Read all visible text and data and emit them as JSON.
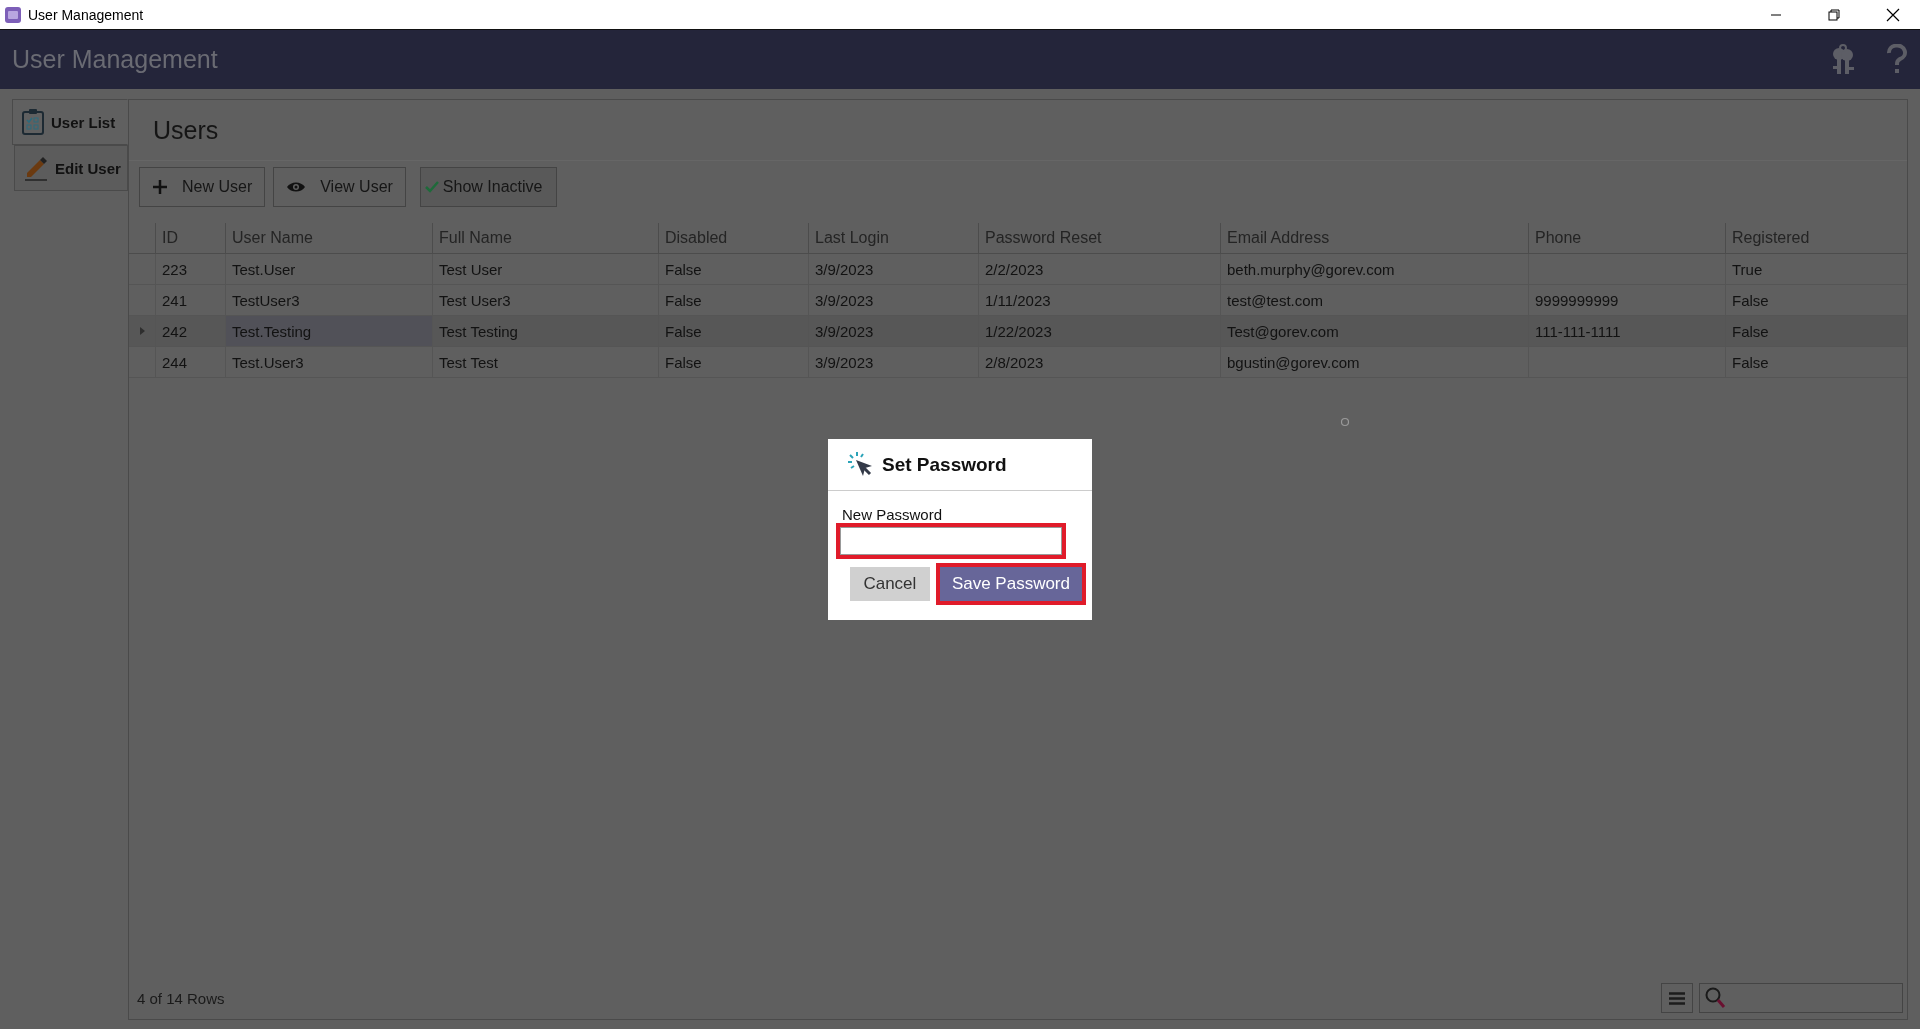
{
  "window": {
    "title": "User Management"
  },
  "header": {
    "title": "User Management"
  },
  "tabs": [
    {
      "label": "User List",
      "selected": true
    },
    {
      "label": "Edit User",
      "selected": false
    }
  ],
  "panel": {
    "title": "Users"
  },
  "toolbar": [
    {
      "label": "New User",
      "kind": "button"
    },
    {
      "label": "View User",
      "kind": "button"
    },
    {
      "label": "Show Inactive",
      "kind": "toggle",
      "checked": true
    }
  ],
  "table": {
    "columns": [
      "ID",
      "User Name",
      "Full Name",
      "Disabled",
      "Last Login",
      "Password Reset",
      "Email Address",
      "Phone",
      "Registered"
    ],
    "rows": [
      {
        "selected": false,
        "cells": [
          "223",
          "Test.User",
          "Test User",
          "False",
          "3/9/2023",
          "2/2/2023",
          "beth.murphy@gorev.com",
          "",
          "True"
        ]
      },
      {
        "selected": false,
        "cells": [
          "241",
          "TestUser3",
          "Test User3",
          "False",
          "3/9/2023",
          "1/11/2023",
          "test@test.com",
          "9999999999",
          "False"
        ]
      },
      {
        "selected": true,
        "cells": [
          "242",
          "Test.Testing",
          "Test Testing",
          "False",
          "3/9/2023",
          "1/22/2023",
          "Test@gorev.com",
          "111-111-1111",
          "False"
        ]
      },
      {
        "selected": false,
        "cells": [
          "244",
          "Test.User3",
          "Test Test",
          "False",
          "3/9/2023",
          "2/8/2023",
          "bgustin@gorev.com",
          "",
          "False"
        ]
      }
    ]
  },
  "status_bar": {
    "row_count": "4 of 14 Rows"
  },
  "dialog": {
    "title": "Set Password",
    "field": {
      "label": "New Password",
      "highlighted": true
    },
    "buttons": [
      {
        "label": "Cancel",
        "kind": "secondary",
        "highlighted": false
      },
      {
        "label": "Save Password",
        "kind": "primary",
        "highlighted": true
      }
    ]
  }
}
